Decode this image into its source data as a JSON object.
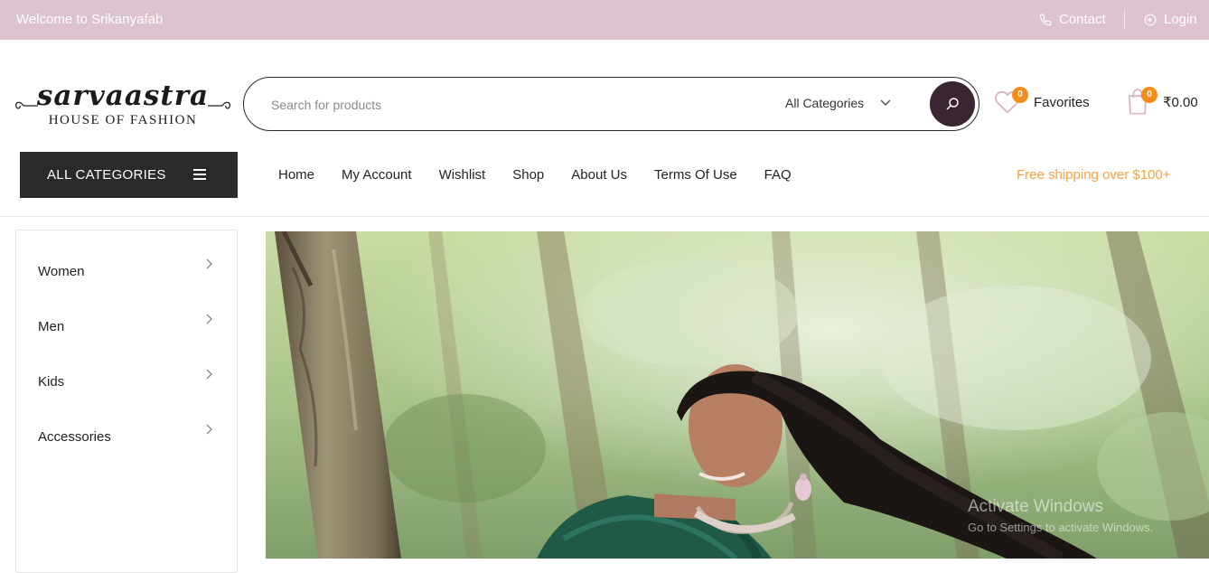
{
  "topbar": {
    "welcome": "Welcome to Srikanyafab",
    "contact": "Contact",
    "login": "Login"
  },
  "logo": {
    "name": "sarvaastra",
    "tagline": "HOUSE OF FASHION"
  },
  "search": {
    "placeholder": "Search for products",
    "category": "All Categories"
  },
  "header": {
    "favorites_label": "Favorites",
    "favorites_count": "0",
    "cart_count": "0",
    "cart_total": "₹0.00"
  },
  "nav": {
    "all_categories": "ALL CATEGORIES",
    "links": [
      "Home",
      "My Account",
      "Wishlist",
      "Shop",
      "About Us",
      "Terms Of Use",
      "FAQ"
    ],
    "shipping_note": "Free shipping over $100+"
  },
  "sidebar": {
    "categories": [
      "Women",
      "Men",
      "Kids",
      "Accessories"
    ]
  },
  "watermark": {
    "title": "Activate Windows",
    "subtitle": "Go to Settings to activate Windows."
  },
  "colors": {
    "topbar": "#dcc3cf",
    "accent": "#f5a33c",
    "badge": "#f28d18",
    "search_button": "#3a2632",
    "dark": "#2a2a2a"
  }
}
